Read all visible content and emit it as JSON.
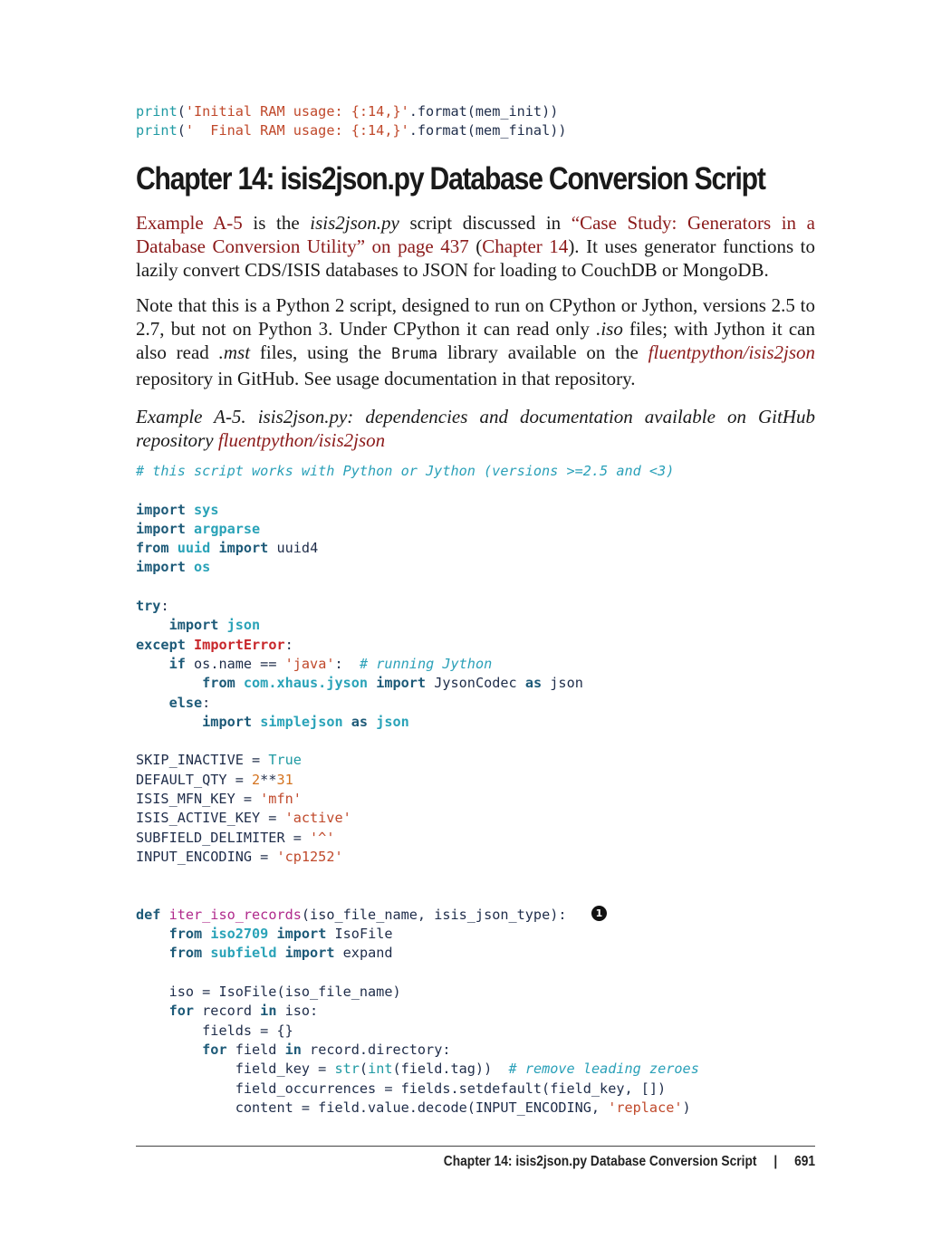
{
  "top_code": {
    "line1": {
      "fn": "print",
      "open": "(",
      "str": "'Initial RAM usage: {:14,}'",
      "rest": ".format(mem_init))"
    },
    "line2": {
      "fn": "print",
      "open": "(",
      "str": "'  Final RAM usage: {:14,}'",
      "rest": ".format(mem_final))"
    }
  },
  "heading": "Chapter 14: isis2json.py Database Conversion Script",
  "para1": {
    "link1": "Example A-5",
    "t1": " is the ",
    "file": "isis2json.py",
    "t2": " script discussed in ",
    "link2": "“Case Study: Generators in a Database Conversion Utility” on page 437",
    "t3": " (",
    "link3": "Chapter 14",
    "t4": "). It uses generator functions to lazily convert CDS/ISIS databases to JSON for loading to CouchDB or MongoDB."
  },
  "para2": {
    "t1": "Note that this is a Python 2 script, designed to run on CPython or Jython, versions 2.5 to 2.7, but not on Python 3. Under CPython it can read only ",
    "iso": ".iso",
    "t2": " files; with Jython it can also read ",
    "mst": ".mst",
    "t3": " files, using the ",
    "lib": "Bruma",
    "t4": " library available on the ",
    "repo": "fluentpython/isis2json",
    "t5": " repository in GitHub. See usage documentation in that repository."
  },
  "caption": {
    "text": "Example A-5. isis2json.py: dependencies and documentation available on GitHub repository ",
    "link": "fluentpython/isis2json"
  },
  "code": {
    "comment_top": "# this script works with Python or Jython (versions >=2.5 and <3)",
    "kw_import": "import",
    "kw_from": "from",
    "kw_try": "try",
    "kw_except": "except",
    "kw_if": "if",
    "kw_else": "else",
    "kw_as": "as",
    "kw_def": "def",
    "kw_for": "for",
    "kw_in": "in",
    "mod_sys": "sys",
    "mod_argparse": "argparse",
    "mod_uuid": "uuid",
    "name_uuid4": "uuid4",
    "mod_os": "os",
    "mod_json": "json",
    "exc": "ImportError",
    "os_name": "os.name == ",
    "str_java": "'java'",
    "comment_jython": "# running Jython",
    "mod_jyson": "com.xhaus.jyson",
    "name_codec": "JysonCodec",
    "name_json": "json",
    "mod_simplejson": "simplejson",
    "c1_name": "SKIP_INACTIVE = ",
    "c1_val": "True",
    "c2_name": "DEFAULT_QTY = ",
    "c2_a": "2",
    "c2_op": "**",
    "c2_b": "31",
    "c3_name": "ISIS_MFN_KEY = ",
    "c3_val": "'mfn'",
    "c4_name": "ISIS_ACTIVE_KEY = ",
    "c4_val": "'active'",
    "c5_name": "SUBFIELD_DELIMITER = ",
    "c5_val": "'^'",
    "c6_name": "INPUT_ENCODING = ",
    "c6_val": "'cp1252'",
    "def_name": "iter_iso_records",
    "def_args": "(iso_file_name, isis_json_type):",
    "callout": "1",
    "mod_iso2709": "iso2709",
    "name_isofile": "IsoFile",
    "mod_subfield": "subfield",
    "name_expand": "expand",
    "l_iso": "iso = IsoFile(iso_file_name)",
    "l_for1_a": " record ",
    "l_for1_b": " iso:",
    "l_fields": "fields = {}",
    "l_for2_a": " field ",
    "l_for2_b": " record.directory:",
    "l_key_a": "field_key = ",
    "l_key_str": "str",
    "l_key_b": "(",
    "l_key_int": "int",
    "l_key_c": "(field.tag))",
    "comment_zeroes": "# remove leading zeroes",
    "l_occ": "field_occurrences = fields.setdefault(field_key, [])",
    "l_content_a": "content = field.value.decode(INPUT_ENCODING, ",
    "str_replace": "'replace'",
    "l_content_b": ")"
  },
  "footer": {
    "title": "Chapter 14: isis2json.py Database Conversion Script",
    "separator": "|",
    "page": "691"
  }
}
